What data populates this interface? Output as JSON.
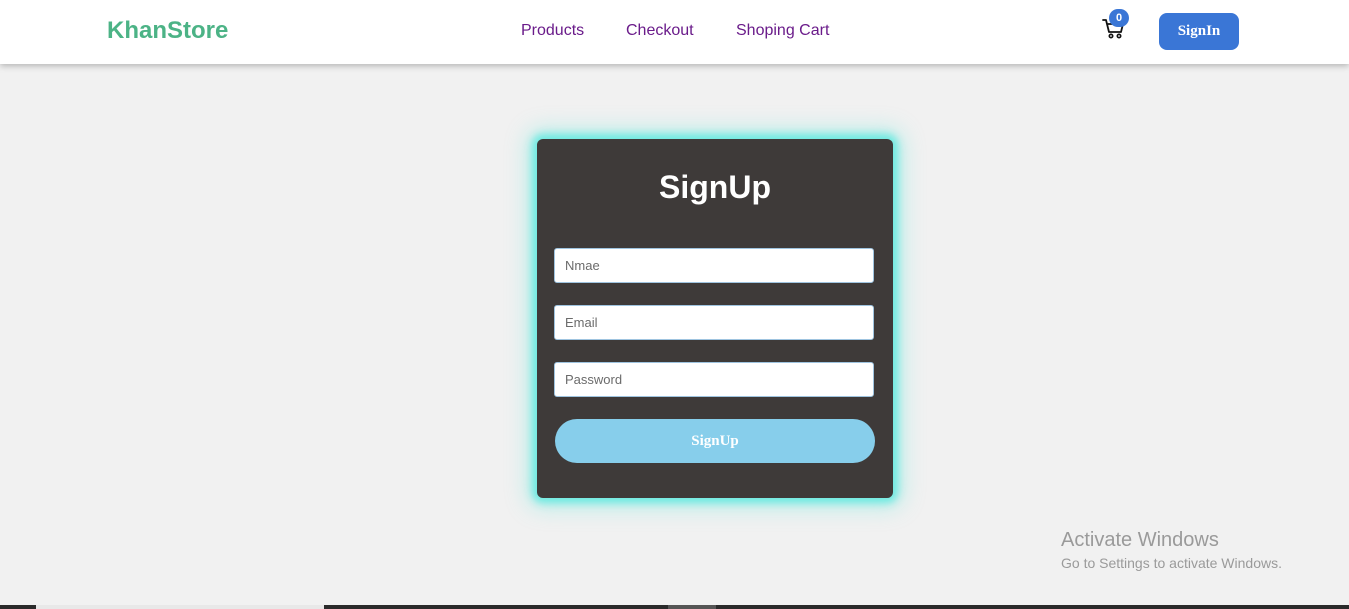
{
  "navbar": {
    "brand": "KhanStore",
    "brand_color": "#4cb386",
    "links": [
      "Products",
      "Checkout",
      "Shoping Cart"
    ],
    "cart_icon": "shopping-cart-icon",
    "cart_count": "0",
    "signin_label": "SignIn",
    "accent_color": "#3a76d6"
  },
  "form": {
    "title": "SignUp",
    "name_placeholder": "Nmae",
    "email_placeholder": "Email",
    "password_placeholder": "Password",
    "submit_label": "SignUp",
    "card_color": "#3e3a39",
    "glow_color": "#52e8de",
    "button_color": "#87ceeb"
  },
  "watermark": {
    "title": "Activate Windows",
    "subtitle": "Go to Settings to activate Windows."
  }
}
